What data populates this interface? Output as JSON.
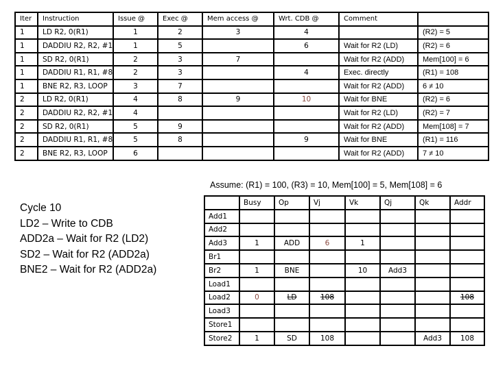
{
  "instruction_table": {
    "headers": [
      "Iter",
      "Instruction",
      "Issue @",
      "Exec @",
      "Mem access @",
      "Wrt. CDB @",
      "Comment",
      ""
    ],
    "rows": [
      {
        "iter": "1",
        "instruction": "LD R2, 0(R1)",
        "issue": "1",
        "exec": "2",
        "mem": "3",
        "cdb": "4",
        "comment": "",
        "result": "(R2) = 5"
      },
      {
        "iter": "1",
        "instruction": "DADDIU R2, R2, #1",
        "issue": "1",
        "exec": "5",
        "mem": "",
        "cdb": "6",
        "comment": "Wait for R2 (LD)",
        "result": "(R2) = 6"
      },
      {
        "iter": "1",
        "instruction": "SD R2, 0(R1)",
        "issue": "2",
        "exec": "3",
        "mem": "7",
        "cdb": "",
        "comment": "Wait for R2 (ADD)",
        "result": "Mem[100] = 6"
      },
      {
        "iter": "1",
        "instruction": "DADDIU R1, R1, #8",
        "issue": "2",
        "exec": "3",
        "mem": "",
        "cdb": "4",
        "comment": "Exec. directly",
        "result": "(R1) = 108"
      },
      {
        "iter": "1",
        "instruction": "BNE R2, R3, LOOP",
        "issue": "3",
        "exec": "7",
        "mem": "",
        "cdb": "",
        "comment": "Wait for R2 (ADD)",
        "result": "6 ≠ 10"
      },
      {
        "iter": "2",
        "instruction": "LD R2, 0(R1)",
        "issue": "4",
        "exec": "8",
        "mem": "9",
        "cdb": "10",
        "comment": "Wait for BNE",
        "result": "(R2) = 6"
      },
      {
        "iter": "2",
        "instruction": "DADDIU R2, R2, #1",
        "issue": "4",
        "exec": "",
        "mem": "",
        "cdb": "",
        "comment": "Wait for R2 (LD)",
        "result": "(R2) = 7"
      },
      {
        "iter": "2",
        "instruction": "SD R2, 0(R1)",
        "issue": "5",
        "exec": "9",
        "mem": "",
        "cdb": "",
        "comment": "Wait for R2 (ADD)",
        "result": "Mem[108] = 7"
      },
      {
        "iter": "2",
        "instruction": "DADDIU R1, R1, #8",
        "issue": "5",
        "exec": "8",
        "mem": "",
        "cdb": "9",
        "comment": "Wait for BNE",
        "result": "(R1) = 116"
      },
      {
        "iter": "2",
        "instruction": "BNE R2, R3, LOOP",
        "issue": "6",
        "exec": "",
        "mem": "",
        "cdb": "",
        "comment": "Wait for R2 (ADD)",
        "result": "7 ≠ 10"
      }
    ]
  },
  "assumption": "Assume: (R1) = 100, (R3) = 10, Mem[100] = 5, Mem[108] = 6",
  "notes": [
    "Cycle 10",
    "LD2 – Write to CDB",
    "ADD2a – Wait for R2 (LD2)",
    "SD2 – Wait for R2 (ADD2a)",
    "BNE2 – Wait for R2 (ADD2a)"
  ],
  "reservation_stations": {
    "headers": [
      "",
      "Busy",
      "Op",
      "Vj",
      "Vk",
      "Qj",
      "Qk",
      "Addr"
    ],
    "rows": [
      {
        "name": "Add1",
        "busy": "",
        "op": "",
        "vj": "",
        "vk": "",
        "qj": "",
        "qk": "",
        "addr": ""
      },
      {
        "name": "Add2",
        "busy": "",
        "op": "",
        "vj": "",
        "vk": "",
        "qj": "",
        "qk": "",
        "addr": ""
      },
      {
        "name": "Add3",
        "busy": "1",
        "op": "ADD",
        "vj": "6",
        "vk": "1",
        "qj": "",
        "qk": "",
        "addr": ""
      },
      {
        "name": "Br1",
        "busy": "",
        "op": "",
        "vj": "",
        "vk": "",
        "qj": "",
        "qk": "",
        "addr": ""
      },
      {
        "name": "Br2",
        "busy": "1",
        "op": "BNE",
        "vj": "",
        "vk": "10",
        "qj": "Add3",
        "qk": "",
        "addr": ""
      },
      {
        "name": "Load1",
        "busy": "",
        "op": "",
        "vj": "",
        "vk": "",
        "qj": "",
        "qk": "",
        "addr": ""
      },
      {
        "name": "Load2",
        "busy": "0",
        "op": "LD",
        "vj": "108",
        "vk": "",
        "qj": "",
        "qk": "",
        "addr": "108"
      },
      {
        "name": "Load3",
        "busy": "",
        "op": "",
        "vj": "",
        "vk": "",
        "qj": "",
        "qk": "",
        "addr": ""
      },
      {
        "name": "Store1",
        "busy": "",
        "op": "",
        "vj": "",
        "vk": "",
        "qj": "",
        "qk": "",
        "addr": ""
      },
      {
        "name": "Store2",
        "busy": "1",
        "op": "SD",
        "vj": "108",
        "vk": "",
        "qj": "",
        "qk": "Add3",
        "addr": "108"
      }
    ]
  },
  "colors": {
    "highlight_updated": "#8a4a40",
    "text": "#000000",
    "border": "#000000"
  }
}
